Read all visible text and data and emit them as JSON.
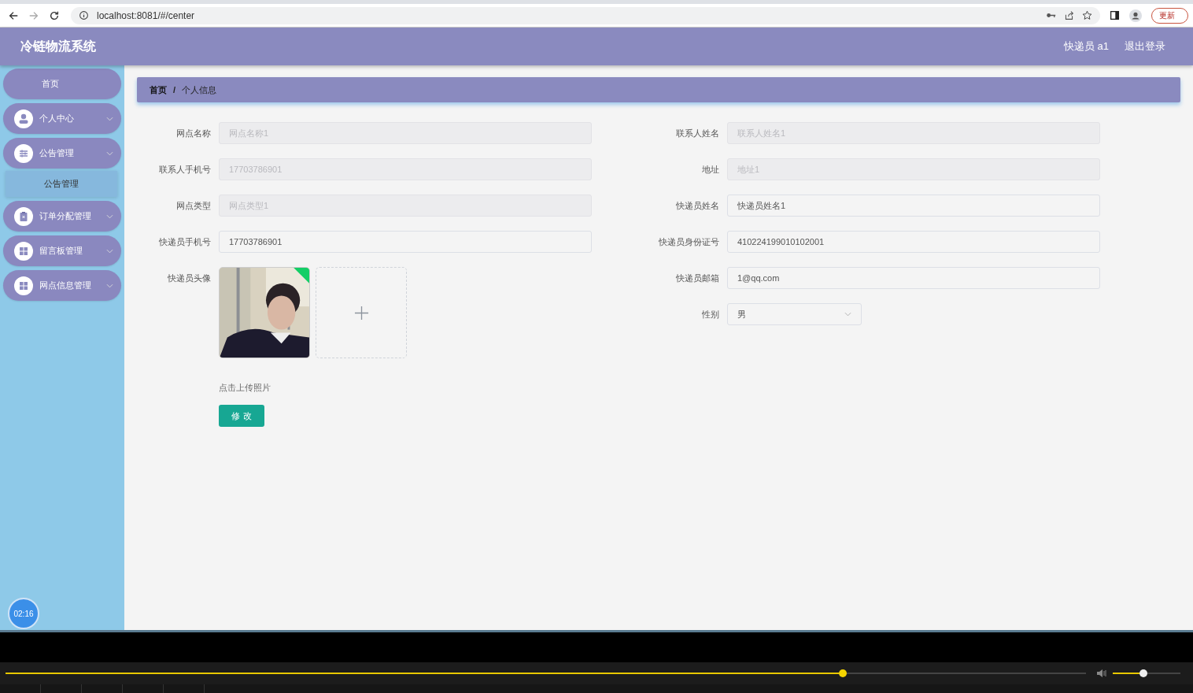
{
  "browser": {
    "url": "localhost:8081/#/center",
    "update_button": "更新"
  },
  "header": {
    "title": "冷链物流系统",
    "user": "快递员 a1",
    "logout": "退出登录"
  },
  "sidebar": {
    "items": [
      {
        "label": "首页",
        "kind": "home"
      },
      {
        "label": "个人中心",
        "kind": "user"
      },
      {
        "label": "公告管理",
        "kind": "sliders",
        "children": [
          {
            "label": "公告管理"
          }
        ]
      },
      {
        "label": "订单分配管理",
        "kind": "clipboard"
      },
      {
        "label": "留言板管理",
        "kind": "grid"
      },
      {
        "label": "网点信息管理",
        "kind": "grid"
      }
    ]
  },
  "breadcrumb": {
    "items": [
      "首页",
      "个人信息"
    ],
    "separator": "/"
  },
  "form": {
    "left": [
      {
        "label": "网点名称",
        "kind": "input",
        "value": "网点名称1",
        "disabled": true
      },
      {
        "label": "联系人手机号",
        "kind": "input",
        "value": "17703786901",
        "disabled": true
      },
      {
        "label": "网点类型",
        "kind": "input",
        "value": "网点类型1",
        "disabled": true
      },
      {
        "label": "快递员手机号",
        "kind": "input",
        "value": "17703786901",
        "disabled": false
      },
      {
        "label": "快递员头像",
        "kind": "upload",
        "hint": "点击上传照片"
      }
    ],
    "right": [
      {
        "label": "联系人姓名",
        "kind": "input",
        "value": "联系人姓名1",
        "disabled": true
      },
      {
        "label": "地址",
        "kind": "input",
        "value": "地址1",
        "disabled": true
      },
      {
        "label": "快递员姓名",
        "kind": "input",
        "value": "快递员姓名1",
        "disabled": false
      },
      {
        "label": "快递员身份证号",
        "kind": "input",
        "value": "410224199010102001",
        "disabled": false
      },
      {
        "label": "快递员邮箱",
        "kind": "input",
        "value": "1@qq.com",
        "disabled": false
      },
      {
        "label": "性别",
        "kind": "select",
        "value": "男",
        "disabled": false
      }
    ],
    "submit": "修 改"
  },
  "timer": "02:16",
  "player": {
    "progress": {
      "level": 0.775
    },
    "volume": {
      "level": 0.45
    }
  }
}
